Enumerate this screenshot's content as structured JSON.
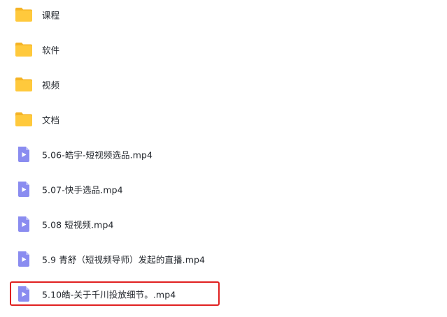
{
  "colors": {
    "folder": "#ffc93c",
    "folder_tab": "#f5b324",
    "video_icon": "#8a8cf0",
    "video_icon_fold": "#b8baf7",
    "text": "#1f2329",
    "highlight": "#e02020"
  },
  "items": [
    {
      "type": "folder",
      "icon": "folder-icon",
      "name": "课程"
    },
    {
      "type": "folder",
      "icon": "folder-icon",
      "name": "软件"
    },
    {
      "type": "folder",
      "icon": "folder-icon",
      "name": "视频"
    },
    {
      "type": "folder",
      "icon": "folder-icon",
      "name": "文档"
    },
    {
      "type": "video",
      "icon": "video-file-icon",
      "name": "5.06-皓宇-短视频选品.mp4"
    },
    {
      "type": "video",
      "icon": "video-file-icon",
      "name": "5.07-快手选品.mp4"
    },
    {
      "type": "video",
      "icon": "video-file-icon",
      "name": "5.08 短视频.mp4"
    },
    {
      "type": "video",
      "icon": "video-file-icon",
      "name": "5.9 青舒（短视频导师）发起的直播.mp4"
    },
    {
      "type": "video",
      "icon": "video-file-icon",
      "name": "5.10皓-关于千川投放细节。.mp4"
    }
  ]
}
